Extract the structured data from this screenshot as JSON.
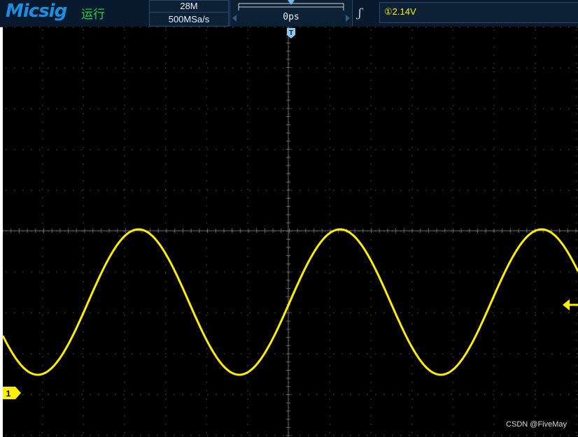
{
  "topbar": {
    "logo": "Micsig",
    "run_status": "运行",
    "memory_depth": "28M",
    "sample_rate": "500MSa/s",
    "trigger_position": "0ps",
    "trigger_marker": "T",
    "trigger_level": "①2.14V"
  },
  "channel": {
    "label": "1",
    "color": "#ffee00"
  },
  "watermark": "CSDN @FiveMay",
  "colors": {
    "accent": "#1a8fe0",
    "running": "#22d24b",
    "trace": "#ffee00",
    "trigger_marker": "#8ec8ee"
  }
}
